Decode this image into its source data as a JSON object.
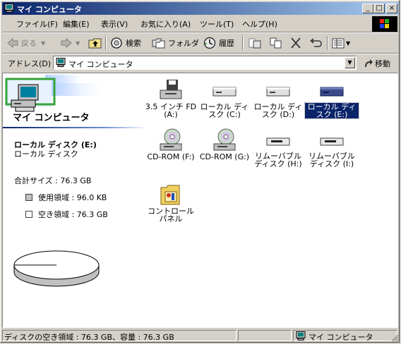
{
  "window": {
    "title": "マイ コンピュータ"
  },
  "title_buttons": {
    "minimize": "_",
    "maximize": "□",
    "close": "×"
  },
  "menu": [
    "ファイル(F)",
    "編集(E)",
    "表示(V)",
    "お気に入り(A)",
    "ツール(T)",
    "ヘルプ(H)"
  ],
  "toolbar": {
    "back": "戻る",
    "search": "検索",
    "folders": "フォルダ",
    "history": "履歴"
  },
  "address": {
    "label": "アドレス(D)",
    "value": "マイ コンピュータ",
    "go": "移動"
  },
  "left_pane": {
    "title": "マイ コンピュータ",
    "selected_name": "ローカル ディスク (E:)",
    "selected_type": "ローカル ディスク",
    "total_size": "合計サイズ : 76.3 GB",
    "used": "使用領域 : 96.0 KB",
    "free": "空き領域 : 76.3 GB"
  },
  "items": [
    {
      "label": "3.5 インチ FD (A:)",
      "icon": "floppy-drive-icon"
    },
    {
      "label": "ローカル ディスク (C:)",
      "icon": "hard-disk-icon"
    },
    {
      "label": "ローカル ディスク (D:)",
      "icon": "hard-disk-icon"
    },
    {
      "label": "ローカル ディスク (E:)",
      "icon": "hard-disk-icon",
      "selected": true
    },
    {
      "label": "CD-ROM (F:)",
      "icon": "cd-drive-icon"
    },
    {
      "label": "CD-ROM (G:)",
      "icon": "cd-drive-icon"
    },
    {
      "label": "リムーバブル ディスク (H:)",
      "icon": "removable-disk-icon"
    },
    {
      "label": "リムーバブル ディスク (I:)",
      "icon": "removable-disk-icon"
    },
    {
      "label": "コントロール パネル",
      "icon": "control-panel-icon"
    }
  ],
  "status": {
    "left": "ディスクの空き領域 : 76.3 GB、容量 : 76.3 GB",
    "right": "マイ コンピュータ"
  },
  "colors": {
    "titlebar": "#0a246a",
    "face": "#d4d0c8",
    "selection": "#0a246a"
  }
}
